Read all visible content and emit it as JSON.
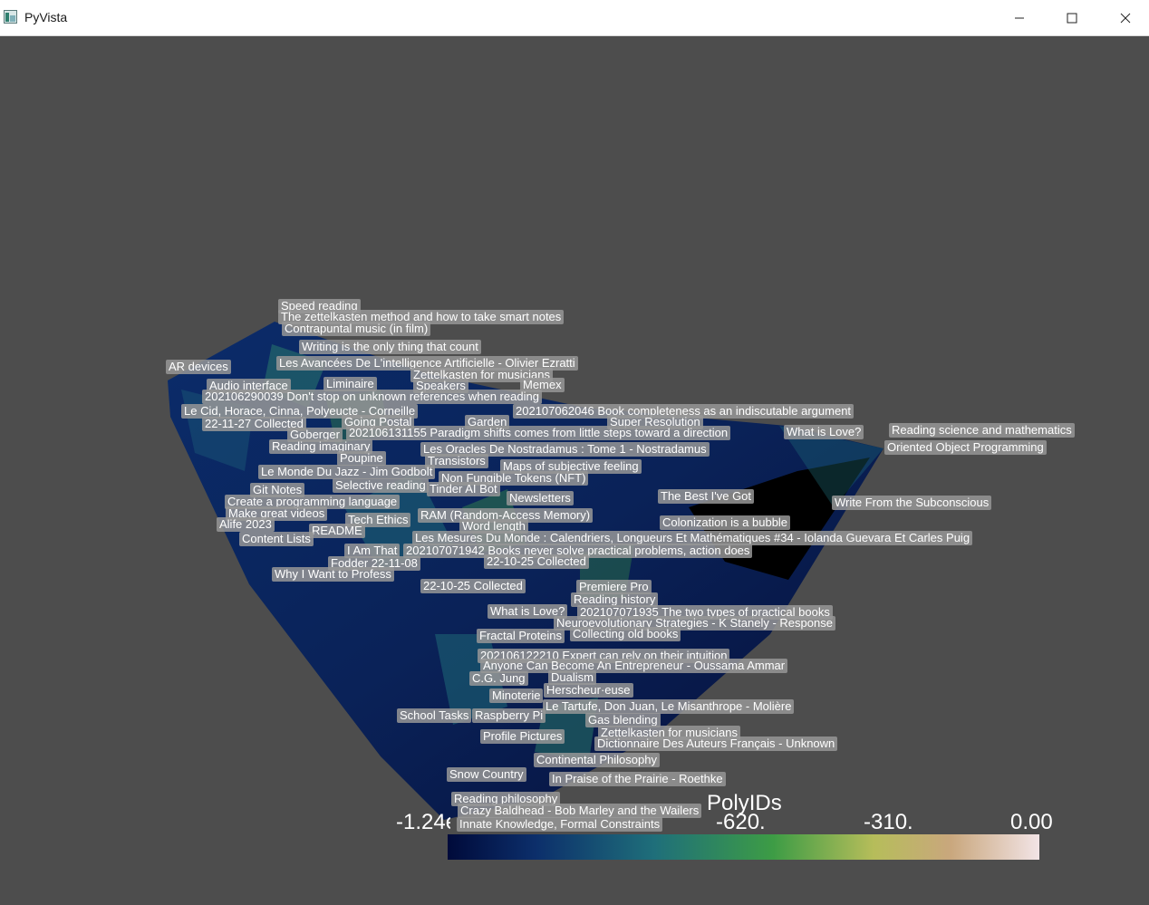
{
  "window": {
    "title": "PyVista",
    "icon": "pyvista-app-icon",
    "controls": {
      "minimize": "minimize-icon",
      "maximize": "maximize-icon",
      "close": "close-icon"
    }
  },
  "colors": {
    "background": "#4d4d4d",
    "titlebar": "#ffffff",
    "label_bg": "#999999"
  },
  "labels": [
    "Speed reading",
    "The zettelkasten method and how to take smart notes",
    "Contrapuntal music (in film)",
    "Writing is the only thing that count",
    "AR devices",
    "Les Avancées De L'intelligence Artificielle  - Olivier Ezratti",
    "Zettelkasten for musicians",
    "Audio interface",
    "Liminaire",
    "Speakers",
    "Memex",
    "202106290039 Don't stop on unknown references when reading",
    "Le Cid, Horace, Cinna, Polyeucte - Corneille",
    "202107062046 Book completeness as an indiscutable argument",
    "22-11-27 Collected",
    "Going Postal",
    "Garden",
    "Super Resolution",
    "Goberger",
    "202106131155 Paradigm shifts comes from little steps toward a direction",
    "What is Love?",
    "Reading science and mathematics",
    "Reading imaginary",
    "Les Oracles De Nostradamus : Tome 1 - Nostradamus",
    "Oriented Object Programming",
    "Poupine",
    "Transistors",
    "Maps of subjective feeling",
    "Le Monde Du Jazz - Jim Godbolt",
    "Non Fungible Tokens (NFT)",
    "Git Notes",
    "Selective reading",
    "Tinder AI Bot",
    "The Best I've Got",
    "Create a programming language",
    "Newsletters",
    "Write From the Subconscious",
    "Make great videos",
    "RAM (Random-Access Memory)",
    "Tech Ethics",
    "Colonization is a bubble",
    "Alife 2023",
    "README",
    "Word length",
    "Content Lists",
    "Les Mesures Du Monde : Calendriers, Longueurs Et Mathématiques #34 - Iolanda Guevara Et Carles Puig",
    "I Am That",
    "202107071942 Books never solve practical problems, action does",
    "Fodder 22-11-08",
    "22-10-25 Collected",
    "Why I Want to Profess",
    "22-10-25 Collected",
    "Premiere Pro",
    "Reading history",
    "What is Love?",
    "202107071935 The two types of practical books",
    "Neuroevolutionary Strategies - K Stanely - Response",
    "Fractal Proteins",
    "Collecting old books",
    "202106122210 Expert can rely on their intuition",
    "Anyone Can Become An Entrepreneur - Oussama Ammar",
    "C.G. Jung",
    "Dualism",
    "Herscheur·euse",
    "Minoterie",
    "Le Tartufe, Don Juan, Le Misanthrope - Molière",
    "School Tasks",
    "Raspberry Pi",
    "Gas blending",
    "Zettelkasten for musicians",
    "Profile Pictures",
    "Dictionnaire Des Auteurs Français - Unknown",
    "Continental Philosophy",
    "Snow Country",
    "In Praise of the Prairie - Roethke",
    "Reading philosophy",
    "Crazy Baldhead - Bob Marley and the Wailers",
    "Innate Knowledge, Formal Constraints"
  ],
  "scalar_bar": {
    "title": "PolyIDs",
    "ticks": [
      "-1.24e+03",
      "-620.",
      "-310.",
      "0.00"
    ],
    "range": [
      -1240,
      0
    ],
    "colormap": [
      "#000a3a",
      "#0c2f6b",
      "#1f6f7a",
      "#3d9c45",
      "#b6bd5a",
      "#c9a77d",
      "#f2e4e6"
    ]
  }
}
